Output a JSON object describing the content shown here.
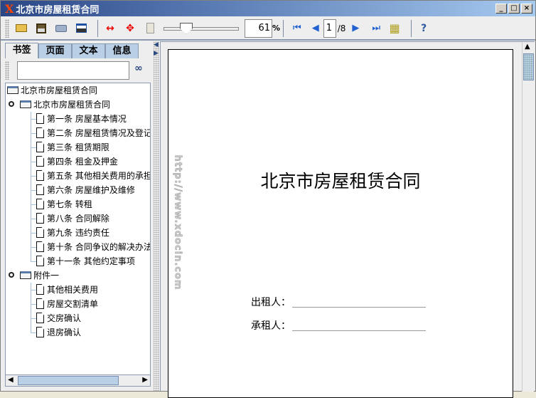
{
  "window": {
    "title": "北京市房屋租赁合同",
    "logo": "X",
    "controls": [
      "_",
      "□",
      "×"
    ]
  },
  "toolbar": {
    "zoom_value": "61",
    "zoom_unit": "%",
    "page_current": "1",
    "page_total": "/8",
    "zoom_level_percent": 61
  },
  "left_panel": {
    "tabs": [
      "书签",
      "页面",
      "文本",
      "信息"
    ],
    "search_value": "",
    "tree": {
      "root": "北京市房屋租赁合同",
      "groups": [
        {
          "label": "北京市房屋租赁合同",
          "items": [
            "第一条 房屋基本情况",
            "第二条 房屋租赁情况及登记",
            "第三条 租赁期限",
            "第四条 租金及押金",
            "第五条 其他相关费用的承担",
            "第六条 房屋维护及维修",
            "第七条 转租",
            "第八条 合同解除",
            "第九条 违约责任",
            "第十条 合同争议的解决办法",
            "第十一条 其他约定事项"
          ]
        },
        {
          "label": "附件一",
          "items": [
            "其他相关费用",
            "房屋交割清单",
            "交房确认",
            "退房确认"
          ]
        }
      ]
    }
  },
  "document": {
    "title": "北京市房屋租赁合同",
    "lessor_label": "出租人：",
    "lessee_label": "承租人：",
    "watermark": "http://www.xdocin.com"
  }
}
